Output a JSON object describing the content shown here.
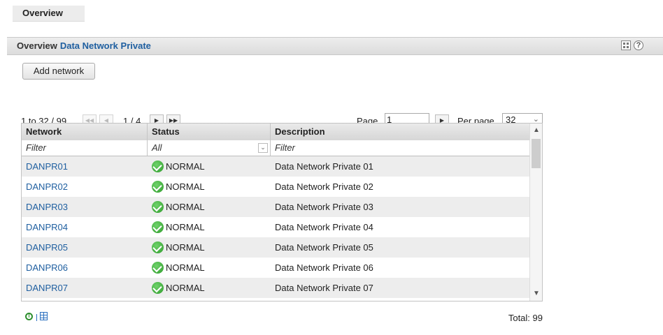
{
  "tab": {
    "label": "Overview"
  },
  "panel": {
    "title_prefix": "Overview",
    "title_name": "Data Network Private",
    "help_glyph": "?"
  },
  "toolbar": {
    "add_label": "Add network"
  },
  "pager": {
    "range_text": "1 to 32 / 99",
    "page_of_text": "1 / 4",
    "page_label": "Page",
    "page_value": "1",
    "per_page_label": "Per page",
    "per_page_value": "32",
    "first_glyph": "◀◀",
    "prev_glyph": "◀",
    "next_glyph": "▶",
    "last_glyph": "▶▶"
  },
  "table": {
    "columns": [
      "Network",
      "Status",
      "Description"
    ],
    "filters": {
      "network": "Filter",
      "status": "All",
      "description": "Filter"
    },
    "rows": [
      {
        "network": "DANPR01",
        "status": "NORMAL",
        "description": "Data Network Private 01"
      },
      {
        "network": "DANPR02",
        "status": "NORMAL",
        "description": "Data Network Private 02"
      },
      {
        "network": "DANPR03",
        "status": "NORMAL",
        "description": "Data Network Private 03"
      },
      {
        "network": "DANPR04",
        "status": "NORMAL",
        "description": "Data Network Private 04"
      },
      {
        "network": "DANPR05",
        "status": "NORMAL",
        "description": "Data Network Private 05"
      },
      {
        "network": "DANPR06",
        "status": "NORMAL",
        "description": "Data Network Private 06"
      },
      {
        "network": "DANPR07",
        "status": "NORMAL",
        "description": "Data Network Private 07"
      }
    ]
  },
  "footer": {
    "total_text": "Total: 99"
  },
  "colors": {
    "link": "#1f5fa0",
    "status_ok": "#2e9b2b",
    "row_alt": "#ededed"
  }
}
